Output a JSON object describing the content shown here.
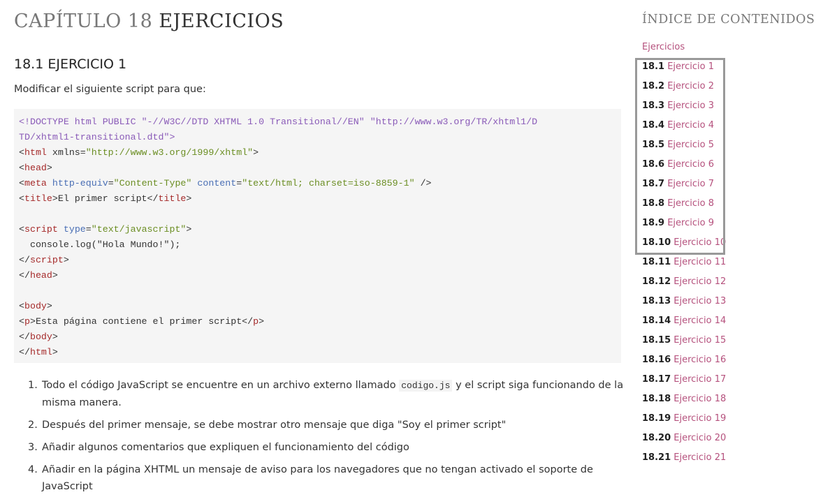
{
  "page": {
    "chapter_prefix": "CAPÍTULO 18",
    "chapter_name": "EJERCICIOS",
    "section_title": "18.1 EJERCICIO 1",
    "intro": "Modificar el siguiente script para que:"
  },
  "code_lines": [
    [
      {
        "t": "<!DOCTYPE html PUBLIC ",
        "c": "doc"
      },
      {
        "t": "\"-//W3C//DTD XHTML 1.0 Transitional//EN\"",
        "c": "doc"
      },
      {
        "t": " ",
        "c": ""
      },
      {
        "t": "\"http://www.w3.org/TR/xhtml1/D",
        "c": "doc"
      }
    ],
    [
      {
        "t": "TD/xhtml1-transitional.dtd\">",
        "c": "doc"
      }
    ],
    [
      {
        "t": "<",
        "c": ""
      },
      {
        "t": "html",
        "c": "tg"
      },
      {
        "t": " xmlns=",
        "c": ""
      },
      {
        "t": "\"http://www.w3.org/1999/xhtml\"",
        "c": "sv"
      },
      {
        "t": ">",
        "c": ""
      }
    ],
    [
      {
        "t": "<",
        "c": ""
      },
      {
        "t": "head",
        "c": "tg"
      },
      {
        "t": ">",
        "c": ""
      }
    ],
    [
      {
        "t": "<",
        "c": ""
      },
      {
        "t": "meta",
        "c": "tg"
      },
      {
        "t": " ",
        "c": ""
      },
      {
        "t": "http-equiv",
        "c": "at"
      },
      {
        "t": "=",
        "c": ""
      },
      {
        "t": "\"Content-Type\"",
        "c": "sv"
      },
      {
        "t": " ",
        "c": ""
      },
      {
        "t": "content",
        "c": "at"
      },
      {
        "t": "=",
        "c": ""
      },
      {
        "t": "\"text/html; charset=iso-8859-1\"",
        "c": "sv"
      },
      {
        "t": " />",
        "c": ""
      }
    ],
    [
      {
        "t": "<",
        "c": ""
      },
      {
        "t": "title",
        "c": "tg"
      },
      {
        "t": ">El primer script</",
        "c": ""
      },
      {
        "t": "title",
        "c": "tg"
      },
      {
        "t": ">",
        "c": ""
      }
    ],
    [],
    [
      {
        "t": "<",
        "c": ""
      },
      {
        "t": "script",
        "c": "tg"
      },
      {
        "t": " ",
        "c": ""
      },
      {
        "t": "type",
        "c": "at"
      },
      {
        "t": "=",
        "c": ""
      },
      {
        "t": "\"text/javascript\"",
        "c": "sv"
      },
      {
        "t": ">",
        "c": ""
      }
    ],
    [
      {
        "t": "  console.log(\"Hola Mundo!\");",
        "c": ""
      }
    ],
    [
      {
        "t": "</",
        "c": ""
      },
      {
        "t": "script",
        "c": "tg"
      },
      {
        "t": ">",
        "c": ""
      }
    ],
    [
      {
        "t": "</",
        "c": ""
      },
      {
        "t": "head",
        "c": "tg"
      },
      {
        "t": ">",
        "c": ""
      }
    ],
    [],
    [
      {
        "t": "<",
        "c": ""
      },
      {
        "t": "body",
        "c": "tg"
      },
      {
        "t": ">",
        "c": ""
      }
    ],
    [
      {
        "t": "<",
        "c": ""
      },
      {
        "t": "p",
        "c": "tg"
      },
      {
        "t": ">Esta página contiene el primer script</",
        "c": ""
      },
      {
        "t": "p",
        "c": "tg"
      },
      {
        "t": ">",
        "c": ""
      }
    ],
    [
      {
        "t": "</",
        "c": ""
      },
      {
        "t": "body",
        "c": "tg"
      },
      {
        "t": ">",
        "c": ""
      }
    ],
    [
      {
        "t": "</",
        "c": ""
      },
      {
        "t": "html",
        "c": "tg"
      },
      {
        "t": ">",
        "c": ""
      }
    ]
  ],
  "tasks": [
    {
      "num": "1.",
      "text_before": "Todo el código JavaScript se encuentre en un archivo externo llamado ",
      "code": "codigo.js",
      "text_after": " y el script siga funcionando de la misma manera."
    },
    {
      "num": "2.",
      "text_before": "Después del primer mensaje, se debe mostrar otro mensaje que diga \"Soy el primer script\"",
      "code": "",
      "text_after": ""
    },
    {
      "num": "3.",
      "text_before": "Añadir algunos comentarios que expliquen el funcionamiento del código",
      "code": "",
      "text_after": ""
    },
    {
      "num": "4.",
      "text_before": "Añadir en la página XHTML un mensaje de aviso para los navegadores que no tengan activado el soporte de JavaScript",
      "code": "",
      "text_after": ""
    }
  ],
  "toc": {
    "title": "ÍNDICE DE CONTENIDOS",
    "top_link": "Ejercicios",
    "items": [
      {
        "num": "18.1",
        "label": "Ejercicio 1"
      },
      {
        "num": "18.2",
        "label": "Ejercicio 2"
      },
      {
        "num": "18.3",
        "label": "Ejercicio 3"
      },
      {
        "num": "18.4",
        "label": "Ejercicio 4"
      },
      {
        "num": "18.5",
        "label": "Ejercicio 5"
      },
      {
        "num": "18.6",
        "label": "Ejercicio 6"
      },
      {
        "num": "18.7",
        "label": "Ejercicio 7"
      },
      {
        "num": "18.8",
        "label": "Ejercicio 8"
      },
      {
        "num": "18.9",
        "label": "Ejercicio 9"
      },
      {
        "num": "18.10",
        "label": "Ejercicio 10"
      },
      {
        "num": "18.11",
        "label": "Ejercicio 11"
      },
      {
        "num": "18.12",
        "label": "Ejercicio 12"
      },
      {
        "num": "18.13",
        "label": "Ejercicio 13"
      },
      {
        "num": "18.14",
        "label": "Ejercicio 14"
      },
      {
        "num": "18.15",
        "label": "Ejercicio 15"
      },
      {
        "num": "18.16",
        "label": "Ejercicio 16"
      },
      {
        "num": "18.17",
        "label": "Ejercicio 17"
      },
      {
        "num": "18.18",
        "label": "Ejercicio 18"
      },
      {
        "num": "18.19",
        "label": "Ejercicio 19"
      },
      {
        "num": "18.20",
        "label": "Ejercicio 20"
      },
      {
        "num": "18.21",
        "label": "Ejercicio 21"
      }
    ]
  },
  "colors": {
    "link": "#b5517d",
    "highlight_border": "#999999",
    "code_bg": "#f5f5f5"
  }
}
